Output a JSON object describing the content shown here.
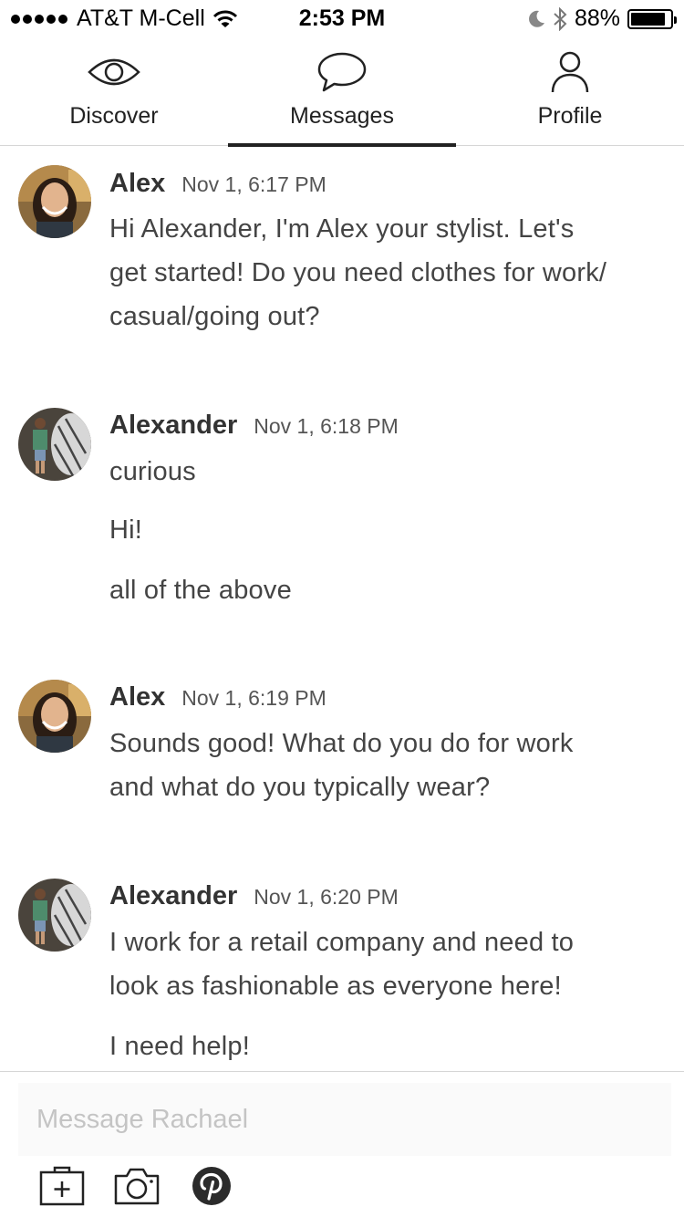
{
  "status_bar": {
    "carrier": "AT&T M-Cell",
    "time": "2:53 PM",
    "battery": "88%",
    "battery_level": 0.88
  },
  "tabs": [
    {
      "label": "Discover",
      "icon": "eye-icon"
    },
    {
      "label": "Messages",
      "icon": "speech-bubble-icon",
      "active": true
    },
    {
      "label": "Profile",
      "icon": "person-icon"
    }
  ],
  "messages": [
    {
      "sender": "Alex",
      "time": "Nov 1, 6:17 PM",
      "avatar": "stylist-avatar",
      "lines": [
        "Hi Alexander, I'm Alex your stylist. Let's",
        "get started! Do you need clothes for work/",
        "casual/going out?"
      ]
    },
    {
      "sender": "Alexander",
      "time": "Nov 1, 6:18 PM",
      "avatar": "user-avatar",
      "lines": [
        "curious",
        "Hi!",
        "all of the above"
      ]
    },
    {
      "sender": "Alex",
      "time": "Nov 1, 6:19 PM",
      "avatar": "stylist-avatar",
      "lines": [
        "Sounds good! What do you do for work",
        "and what do you typically wear?"
      ]
    },
    {
      "sender": "Alexander",
      "time": "Nov 1, 6:20 PM",
      "avatar": "user-avatar",
      "lines": [
        "I work for a retail company and need to",
        "look as fashionable as everyone here!",
        "I need help!"
      ]
    }
  ],
  "composer": {
    "placeholder": "Message Rachael",
    "value": "",
    "tools": [
      "add-bag-icon",
      "camera-icon",
      "pinterest-icon"
    ]
  }
}
